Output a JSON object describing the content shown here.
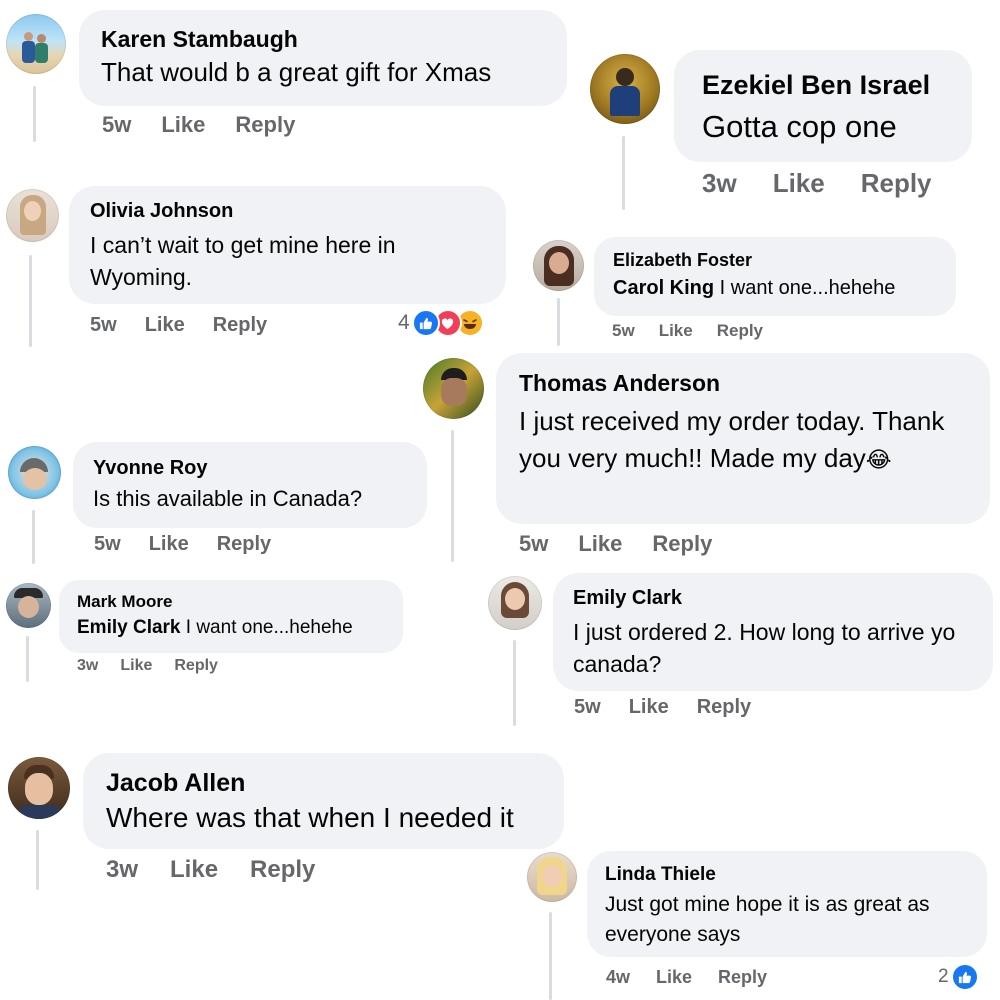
{
  "colors": {
    "bubble": "#f0f2f5",
    "meta_text": "#65676b",
    "like_blue": "#1877f2",
    "love_red": "#f33e58",
    "haha_yellow": "#f7b125"
  },
  "comments": [
    {
      "name": "Karen Stambaugh",
      "text": "That would b a great gift for Xmas",
      "time": "5w",
      "like": "Like",
      "reply": "Reply"
    },
    {
      "name": "Ezekiel Ben Israel",
      "text": "Gotta cop one",
      "time": "3w",
      "like": "Like",
      "reply": "Reply"
    },
    {
      "name": "Olivia Johnson",
      "text": "I can’t wait to get mine here in Wyoming.",
      "time": "5w",
      "like": "Like",
      "reply": "Reply",
      "reaction_count": "4",
      "reaction_icons": [
        "like-icon",
        "love-icon",
        "haha-icon"
      ]
    },
    {
      "name": "Elizabeth Foster",
      "tag": "Carol King",
      "text": " I want one...hehehe",
      "time": "5w",
      "like": "Like",
      "reply": "Reply"
    },
    {
      "name": "Thomas Anderson",
      "text": "I just received my order today. Thank you very much!! Made my day",
      "emoji": "😂",
      "time": "5w",
      "like": "Like",
      "reply": "Reply"
    },
    {
      "name": "Yvonne Roy",
      "text": "Is this available in Canada?",
      "time": "5w",
      "like": "Like",
      "reply": "Reply"
    },
    {
      "name": "Mark Moore",
      "tag": "Emily Clark",
      "text": " I want one...hehehe",
      "time": "3w",
      "like": "Like",
      "reply": "Reply"
    },
    {
      "name": "Emily Clark",
      "text": "I just ordered 2. How long to arrive yo canada?",
      "time": "5w",
      "like": "Like",
      "reply": "Reply"
    },
    {
      "name": "Jacob Allen",
      "text": "Where was that when I needed it",
      "time": "3w",
      "like": "Like",
      "reply": "Reply"
    },
    {
      "name": "Linda Thiele",
      "text": "Just got mine hope it is as great as everyone says",
      "time": "4w",
      "like": "Like",
      "reply": "Reply",
      "reaction_count": "2",
      "reaction_icons": [
        "like-icon"
      ]
    }
  ]
}
